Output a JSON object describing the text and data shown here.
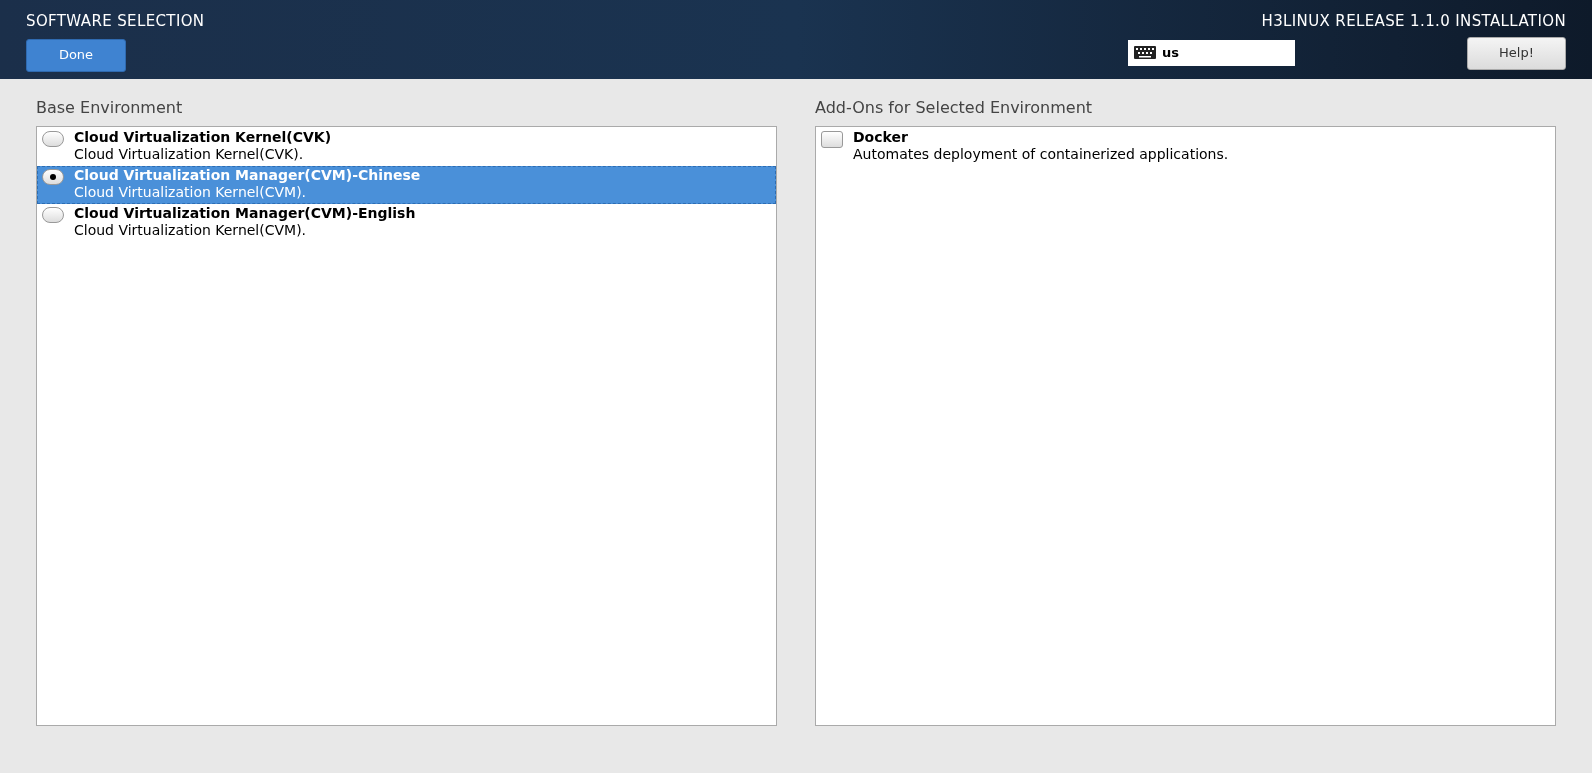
{
  "header": {
    "title": "SOFTWARE SELECTION",
    "done_button": "Done",
    "product": "H3LINUX RELEASE 1.1.0 INSTALLATION",
    "keyboard_layout": "us",
    "help_button": "Help!"
  },
  "base_environment": {
    "heading": "Base Environment",
    "items": [
      {
        "name": "Cloud Virtualization Kernel(CVK)",
        "description": "Cloud Virtualization Kernel(CVK).",
        "selected": false
      },
      {
        "name": "Cloud Virtualization Manager(CVM)-Chinese",
        "description": "Cloud Virtualization Kernel(CVM).",
        "selected": true
      },
      {
        "name": "Cloud Virtualization Manager(CVM)-English",
        "description": "Cloud Virtualization Kernel(CVM).",
        "selected": false
      }
    ]
  },
  "addons": {
    "heading": "Add-Ons for Selected Environment",
    "items": [
      {
        "name": "Docker",
        "description": "Automates deployment of containerized applications.",
        "checked": false
      }
    ]
  }
}
